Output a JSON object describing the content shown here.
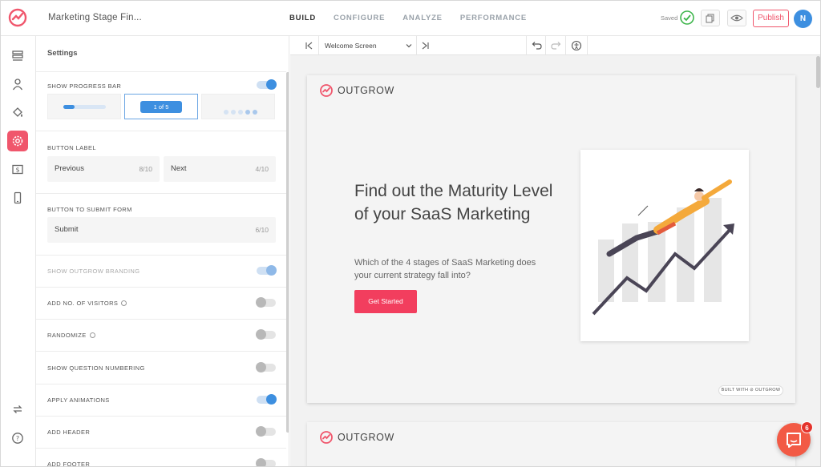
{
  "header": {
    "doc_title": "Marketing Stage Fin...",
    "nav": [
      {
        "label": "BUILD",
        "active": true
      },
      {
        "label": "CONFIGURE",
        "active": false
      },
      {
        "label": "ANALYZE",
        "active": false
      },
      {
        "label": "PERFORMANCE",
        "active": false
      }
    ],
    "saved_label": "Saved",
    "publish_label": "Publish",
    "avatar_initial": "N"
  },
  "rail": {
    "items": [
      "layout-icon",
      "user-icon",
      "paint-bucket-icon",
      "gear-icon",
      "dollar-screen-icon",
      "mobile-icon"
    ],
    "bottom": [
      "swap-icon",
      "help-icon"
    ],
    "active": "gear-icon"
  },
  "settings": {
    "title": "Settings",
    "show_progress_bar": {
      "label": "SHOW PROGRESS BAR",
      "on": true,
      "pill_text": "1 of 5"
    },
    "button_label": {
      "label": "BUTTON LABEL",
      "previous": {
        "text": "Previous",
        "count": "8/10"
      },
      "next": {
        "text": "Next",
        "count": "4/10"
      }
    },
    "submit": {
      "label": "BUTTON TO SUBMIT FORM",
      "text": "Submit",
      "count": "6/10"
    },
    "toggles": [
      {
        "label": "SHOW OUTGROW BRANDING",
        "on": true,
        "disabled": true,
        "info": false
      },
      {
        "label": "ADD NO. OF VISITORS",
        "on": false,
        "disabled": false,
        "info": true
      },
      {
        "label": "RANDOMIZE",
        "on": false,
        "disabled": false,
        "info": true
      },
      {
        "label": "SHOW QUESTION NUMBERING",
        "on": false,
        "disabled": false,
        "info": false
      },
      {
        "label": "APPLY ANIMATIONS",
        "on": true,
        "disabled": false,
        "info": false
      },
      {
        "label": "ADD HEADER",
        "on": false,
        "disabled": false,
        "info": false
      },
      {
        "label": "ADD FOOTER",
        "on": false,
        "disabled": false,
        "info": false
      }
    ]
  },
  "canvas": {
    "screen_select": "Welcome Screen",
    "brand": "OUTGROW",
    "headline": "Find out the Maturity Level of your SaaS Marketing",
    "subtext": "Which of the 4 stages of SaaS Marketing does your current strategy fall into?",
    "cta": "Get Started",
    "built_with": "BUILT WITH ⊘ OUTGROW"
  },
  "chat": {
    "badge": "6"
  },
  "colors": {
    "accent": "#f0566c",
    "blue": "#3d8fe0",
    "cta": "#f23e5e",
    "check": "#3cb54a"
  }
}
